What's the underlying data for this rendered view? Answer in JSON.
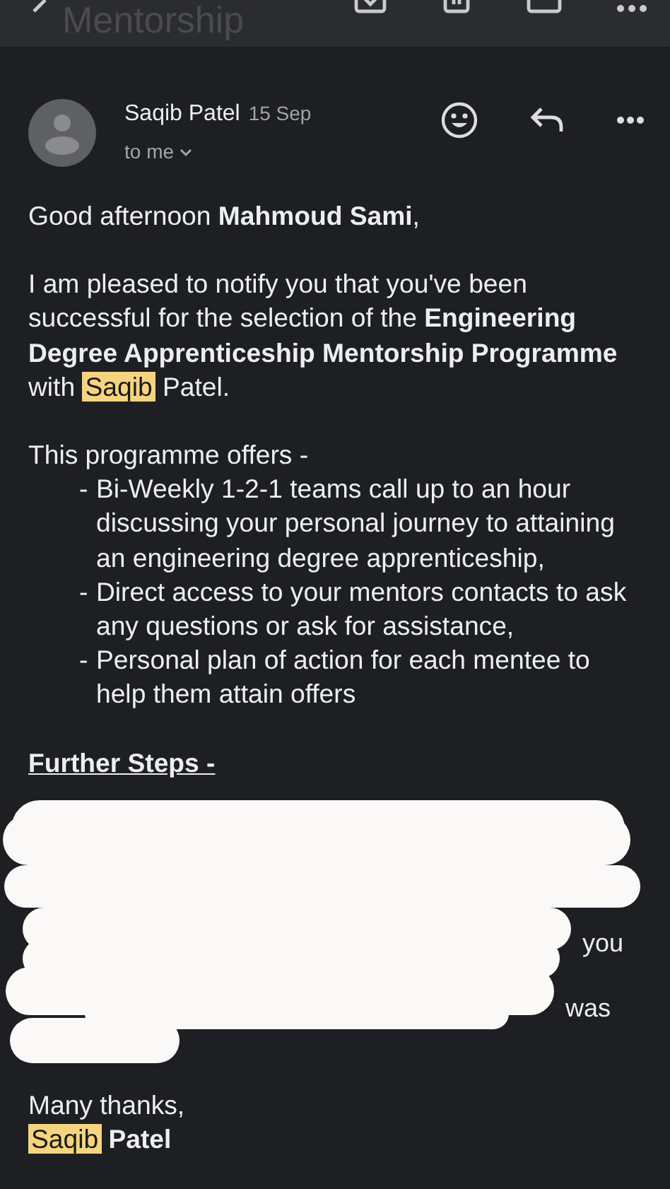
{
  "toolbar": {
    "title": "Mentorship"
  },
  "message": {
    "sender": "Saqib Patel",
    "date": "15 Sep",
    "recipient": "to me"
  },
  "body": [
    {
      "kind": "paragraph",
      "runs": [
        {
          "text": "Good afternoon "
        },
        {
          "text": "Mahmoud Sami",
          "bold": true
        },
        {
          "text": ","
        }
      ]
    },
    {
      "kind": "paragraph",
      "runs": [
        {
          "text": "I am pleased to notify you that you've been successful for the selection of the "
        },
        {
          "text": "Engineering Degree Apprenticeship Mentorship Programme",
          "bold": true
        },
        {
          "text": " with "
        },
        {
          "text": "Saqib",
          "highlight": true
        },
        {
          "text": " Patel."
        }
      ]
    },
    {
      "kind": "list",
      "intro": "This programme offers -",
      "items": [
        {
          "bullet": "-",
          "text": "Bi-Weekly 1-2-1 teams call up to an hour discussing your personal journey to attaining an engineering degree apprenticeship,"
        },
        {
          "bullet": "-",
          "text": "Direct access to your mentors contacts to ask any questions or ask for assistance,"
        },
        {
          "bullet": "-",
          "text": "Personal plan of action for each mentee to help them attain offers"
        }
      ]
    },
    {
      "kind": "heading",
      "runs": [
        {
          "text": "Further Steps -"
        }
      ]
    },
    {
      "kind": "redacted",
      "fragments": [
        "you",
        "was"
      ]
    },
    {
      "kind": "signoff",
      "runs": [
        {
          "text": "Many thanks,"
        }
      ]
    },
    {
      "kind": "signature",
      "runs": [
        {
          "text": "Saqib",
          "highlight": true
        },
        {
          "text": " Patel",
          "bold": true
        }
      ]
    }
  ]
}
